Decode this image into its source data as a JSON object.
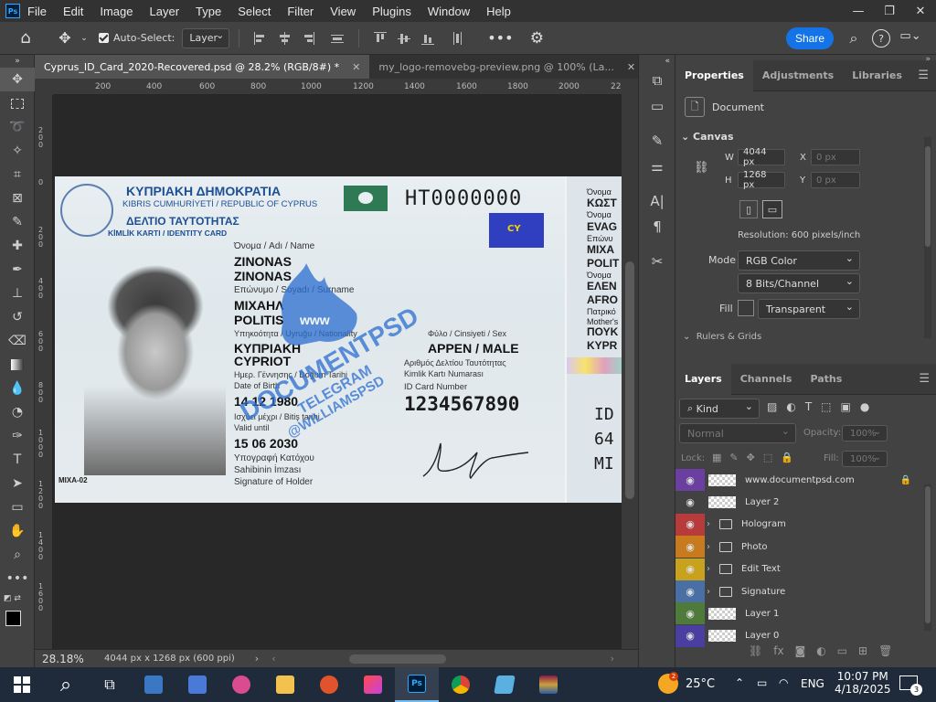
{
  "menubar": {
    "app_icon": "Ps",
    "items": [
      "File",
      "Edit",
      "Image",
      "Layer",
      "Type",
      "Select",
      "Filter",
      "View",
      "Plugins",
      "Window",
      "Help"
    ],
    "window_controls": [
      "—",
      "❐",
      "✕"
    ]
  },
  "options": {
    "auto_select_label": "Auto-Select:",
    "auto_select_value": "Layer",
    "share_label": "Share"
  },
  "tabs": [
    {
      "title": "Cyprus_ID_Card_2020-Recovered.psd @ 28.2% (RGB/8#) *",
      "active": true
    },
    {
      "title": "my_logo-removebg-preview.png @ 100% (La...",
      "active": false
    }
  ],
  "ruler": {
    "h_labels": [
      "200",
      "400",
      "600",
      "800",
      "1000",
      "1200",
      "1400",
      "1600",
      "1800",
      "2000",
      "22"
    ],
    "v_labels": [
      "2 0 0",
      "0",
      "2 0 0",
      "4 0 0",
      "6 0 0",
      "8 0 0",
      "1 0 0 0",
      "1 2 0 0",
      "1 4 0 0",
      "1 6 0 0"
    ]
  },
  "card": {
    "header_gr": "ΚΥΠΡΙΑΚΗ ΔΗΜΟΚΡΑΤΙΑ",
    "header_tr_en": "KIBRIS CUMHURİYETİ / REPUBLIC OF CYPRUS",
    "doc_gr": "ΔΕΛΤΙΟ ΤΑΥΤΟΤΗΤΑΣ",
    "doc_tr_en": "KİMLİK KARTI / IDENTITY CARD",
    "doc_number": "HT0000000",
    "eu_code": "CY",
    "name_label": "Όνομα / Adı / Name",
    "name_1": "ZINONAS",
    "name_2": "ZINONAS",
    "surname_label": "Επώνυμο / Soyadı / Surname",
    "surname_1": "ΜΙΧΑΗΛ",
    "surname_2": "POLITIS",
    "nationality_label": "Υπηκοότητα / Uyruğu / Nationality",
    "nationality_1": "ΚΥΠΡΙΑΚΗ",
    "nationality_2": "CYPRIOT",
    "sex_label": "Φύλο / Cinsiyeti / Sex",
    "sex_value": "ΑΡΡΕΝ / MALE",
    "dob_label_1": "Ημερ. Γέννησης / Doğum Tarihi",
    "dob_label_2": "Date of Birth",
    "dob_value": "14 12 1980",
    "card_no_label_1": "Αριθμός Δελτίου Ταυτότητας",
    "card_no_label_2": "Kimlik Kartı Numarası",
    "card_no_label_3": "ID Card Number",
    "card_no_value": "1234567890",
    "expiry_label_1": "Ισχύει μέχρι / Bitiş tarihi",
    "expiry_label_2": "Valid until",
    "expiry_value": "15 06 2030",
    "sig_label_1": "Υπογραφή Κατόχου",
    "sig_label_2": "Sahibinin İmzası",
    "sig_label_3": "Signature of Holder",
    "photo_code": "MIXA-02",
    "watermark_1": "DOCUMENTPSD",
    "watermark_2": "TELEGRAM",
    "watermark_3": "@WILLIAMSPSD",
    "watermark_logo": "www",
    "back_lines": [
      "Όνομα",
      "ΚΩΣΤ",
      "Όνομα",
      "EVAG",
      "Επώνυ",
      "ΜΙΧΑ",
      "POLIT",
      "Όνομα",
      "ΕΛΕΝ",
      "AFRO",
      "Πατρικό",
      "Mother's",
      "ΠΟΥΚ",
      "KYPR"
    ],
    "back_mrz": [
      "ID",
      "64",
      "MI"
    ]
  },
  "status": {
    "zoom": "28.18%",
    "doc_info": "4044 px x 1268 px (600 ppi)"
  },
  "properties": {
    "tabs": [
      "Properties",
      "Adjustments",
      "Libraries"
    ],
    "doc_label": "Document",
    "canvas_label": "Canvas",
    "w_label": "W",
    "w_value": "4044 px",
    "h_label": "H",
    "h_value": "1268 px",
    "x_label": "X",
    "x_value": "0 px",
    "y_label": "Y",
    "y_value": "0 px",
    "resolution": "Resolution: 600 pixels/inch",
    "mode_label": "Mode",
    "mode_value": "RGB Color",
    "bits_value": "8 Bits/Channel",
    "fill_label": "Fill",
    "fill_value": "Transparent",
    "rulers_label": "Rulers & Grids"
  },
  "layers": {
    "tabs": [
      "Layers",
      "Channels",
      "Paths"
    ],
    "kind": "Kind",
    "blend": "Normal",
    "opacity_label": "Opacity:",
    "opacity_value": "100%",
    "lock_label": "Lock:",
    "fill_label": "Fill:",
    "fill_value": "100%",
    "items": [
      {
        "name": "www.documentpsd.com",
        "color": "#6b3fa0",
        "type": "layer",
        "locked": true
      },
      {
        "name": "Layer 2",
        "color": "#424242",
        "type": "layer",
        "locked": false
      },
      {
        "name": "Hologram",
        "color": "#b83b3b",
        "type": "group",
        "locked": false
      },
      {
        "name": "Photo",
        "color": "#c87a1e",
        "type": "group",
        "locked": false
      },
      {
        "name": "Edit Text",
        "color": "#c9a21d",
        "type": "group",
        "locked": false
      },
      {
        "name": "Signature",
        "color": "#4a6fa5",
        "type": "group",
        "locked": false
      },
      {
        "name": "Layer 1",
        "color": "#4e7a3a",
        "type": "layer",
        "locked": false
      },
      {
        "name": "Layer 0",
        "color": "#4a3fa0",
        "type": "layer",
        "locked": false
      }
    ]
  },
  "taskbar": {
    "temp": "25°C",
    "lang": "ENG",
    "time": "10:07 PM",
    "date": "4/18/2025",
    "weather_badge": "2",
    "notif_badge": "3"
  }
}
